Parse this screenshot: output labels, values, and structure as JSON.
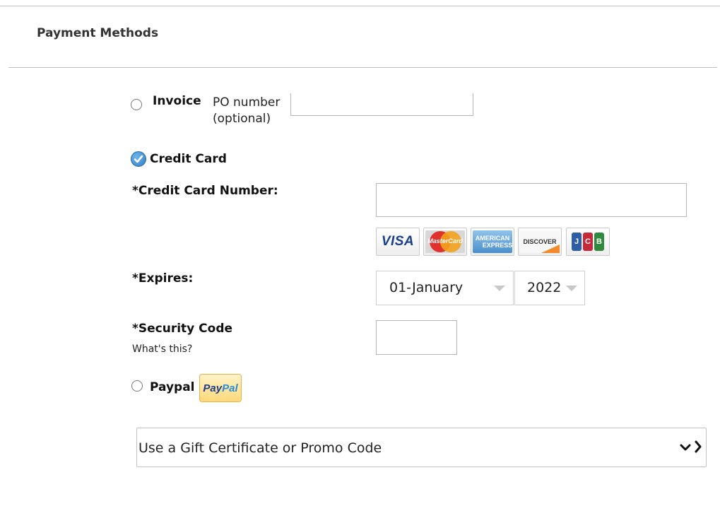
{
  "header": {
    "title": "Payment Methods"
  },
  "invoice": {
    "label": "Invoice",
    "po_label_line1": "PO number",
    "po_label_line2": "(optional)",
    "po_value": "",
    "selected": false
  },
  "credit_card": {
    "label": "Credit Card",
    "selected": true,
    "number_label": "*Credit Card Number:",
    "number_value": "",
    "card_icons": [
      {
        "name": "visa",
        "text": "VISA"
      },
      {
        "name": "mastercard",
        "text": "MasterCard"
      },
      {
        "name": "amex",
        "text_line1": "AMERICAN",
        "text_line2": "EXPRESS"
      },
      {
        "name": "discover",
        "text": "DISCOVER"
      },
      {
        "name": "jcb",
        "text": "JCB"
      }
    ],
    "expires_label": "*Expires:",
    "month_value": "01-January",
    "year_value": "2022",
    "security_label": "*Security Code",
    "security_help": "What's this?",
    "security_value": ""
  },
  "paypal": {
    "label": "Paypal",
    "logo_text_1": "Pay",
    "logo_text_2": "Pal",
    "selected": false
  },
  "promo": {
    "label": "Use a Gift Certificate or Promo Code"
  },
  "colors": {
    "accent": "#2f7fc6",
    "rule": "#bdbdbd",
    "paypal_bg": "#fde8a8"
  }
}
